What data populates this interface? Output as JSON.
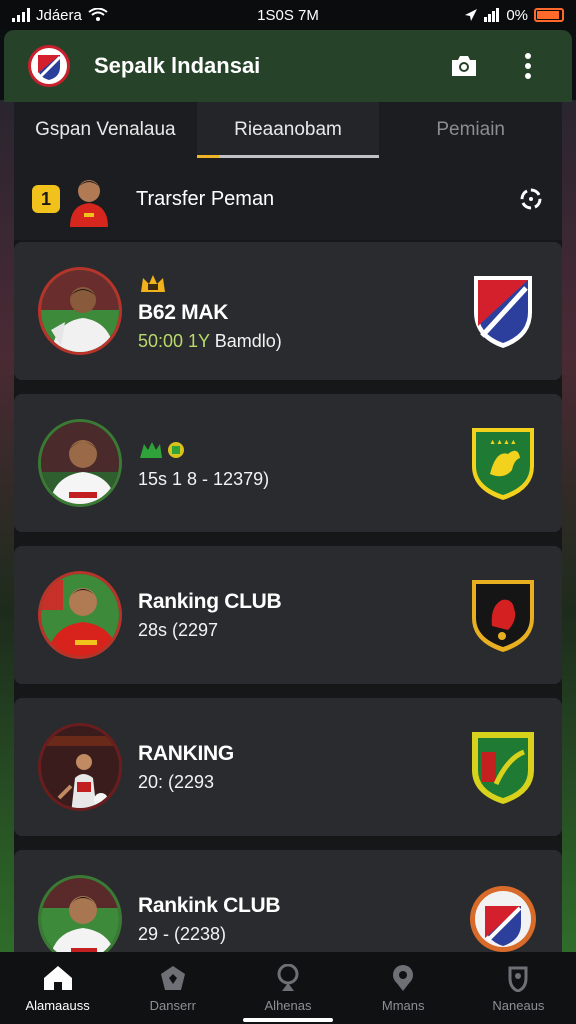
{
  "status_bar": {
    "carrier": "Jdáera",
    "time": "1S0S 7M",
    "battery": "0%"
  },
  "header": {
    "title": "Sepalk lndansai",
    "camera_icon": "camera-icon",
    "menu_icon": "more-vert-icon"
  },
  "tabs": [
    {
      "label": "Gspan Venalaua",
      "state": "normal"
    },
    {
      "label": "Rieaanobam",
      "state": "active"
    },
    {
      "label": "Pemiain",
      "state": "muted"
    }
  ],
  "transfer": {
    "rank": "1",
    "label": "Trarsfer Peman",
    "action_icon": "refresh-icon"
  },
  "cards": [
    {
      "title": "B62 MAK",
      "sub_prefix": "50:00 ",
      "sub_highlight": "1Y",
      "sub_suffix": " Bamdlo)",
      "crest": "shield-crest-red-blue"
    },
    {
      "title": "",
      "sub_prefix": "15s 1 8 - 12379)",
      "sub_highlight": "",
      "sub_suffix": "",
      "crest": "shield-crest-green-yellow"
    },
    {
      "title": "Ranking CLUB",
      "sub_prefix": "28s (2297",
      "sub_highlight": "",
      "sub_suffix": "",
      "crest": "shield-crest-black-red"
    },
    {
      "title": "RANKING",
      "sub_prefix": "20: (2293",
      "sub_highlight": "",
      "sub_suffix": "",
      "crest": "shield-crest-yellow-green"
    },
    {
      "title": "Rankink CLUB",
      "sub_prefix": "29 - (2238)",
      "sub_highlight": "",
      "sub_suffix": "",
      "crest": "round-crest-red-blue"
    }
  ],
  "bottom_nav": [
    {
      "label": "Alamaauss",
      "icon": "home-icon",
      "active": true
    },
    {
      "label": "Danserr",
      "icon": "shield-icon",
      "active": false
    },
    {
      "label": "Alhenas",
      "icon": "trophy-icon",
      "active": false
    },
    {
      "label": "Mmans",
      "icon": "location-icon",
      "active": false
    },
    {
      "label": "Naneaus",
      "icon": "user-icon",
      "active": false
    }
  ],
  "colors": {
    "header_bg": "#26432a",
    "accent": "#f2c21c",
    "card_bg": "#2a2b2e"
  }
}
